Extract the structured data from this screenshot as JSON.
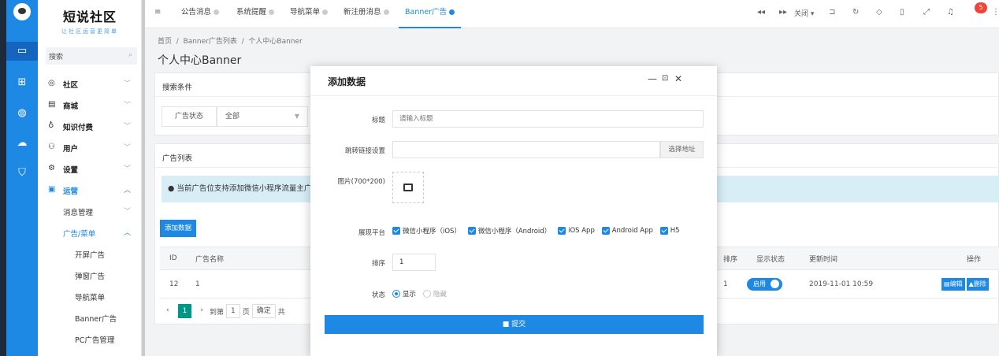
{
  "brand": {
    "title": "短说社区",
    "slogan": "让社区运营更简单"
  },
  "side": {
    "search_label": "搜索",
    "menu": {
      "community": "社区",
      "mall": "商城",
      "knowledge": "知识付费",
      "users": "用户",
      "settings": "设置",
      "operation": "运营",
      "message_mgmt": "消息管理",
      "ads_menu": "广告/菜单",
      "splash_ad": "开屏广告",
      "popup_ad": "弹窗广告",
      "nav_menu": "导航菜单",
      "banner_ad": "Banner广告",
      "pc_ad": "PC广告管理"
    }
  },
  "topbar": {
    "tabs": [
      "公告消息",
      "系统提醒",
      "导航菜单",
      "新注册消息",
      "Banner广告"
    ],
    "close_label": "关闭",
    "badge_count": "5"
  },
  "breadcrumb": {
    "home": "首页",
    "list": "Banner广告列表",
    "current": "个人中心Banner",
    "sep": "/"
  },
  "page_title": "个人中心Banner",
  "search_panel": {
    "header": "搜索条件",
    "status_label": "广告状态",
    "status_value": "全部"
  },
  "list_panel": {
    "header": "广告列表",
    "tip": "当前广告位支持添加微信小程序流量主广",
    "add_button": "添加数据",
    "columns": {
      "id": "ID",
      "name": "广告名称",
      "sort": "排序",
      "display_status": "显示状态",
      "updated": "更新时间",
      "ops": "操作"
    },
    "row": {
      "id": "12",
      "name": "1",
      "sort": "1",
      "status": "启用",
      "updated": "2019-11-01 10:59",
      "edit": "编辑",
      "delete": "删除"
    },
    "pager": {
      "current": "1",
      "goto_label": "到第",
      "goto_value": "1",
      "page_label": "页",
      "confirm": "确定",
      "total": "共"
    }
  },
  "modal": {
    "title": "添加数据",
    "fields": {
      "title_label": "标题",
      "title_placeholder": "请输入标题",
      "link_label": "跳转链接设置",
      "pick_address": "选择地址",
      "image_label": "图片(700*200)",
      "platform_label": "展现平台",
      "platforms": [
        "微信小程序（iOS）",
        "微信小程序（Android）",
        "iOS App",
        "Android App",
        "H5"
      ],
      "sort_label": "排序",
      "sort_value": "1",
      "status_label": "状态",
      "status_show": "显示",
      "status_hide": "隐藏"
    },
    "submit": "提交"
  },
  "colors": {
    "accent": "#1e88e5",
    "rail_bg": "#1e88e5",
    "page_bg": "#f2f3f5",
    "badge": "#f44336"
  }
}
